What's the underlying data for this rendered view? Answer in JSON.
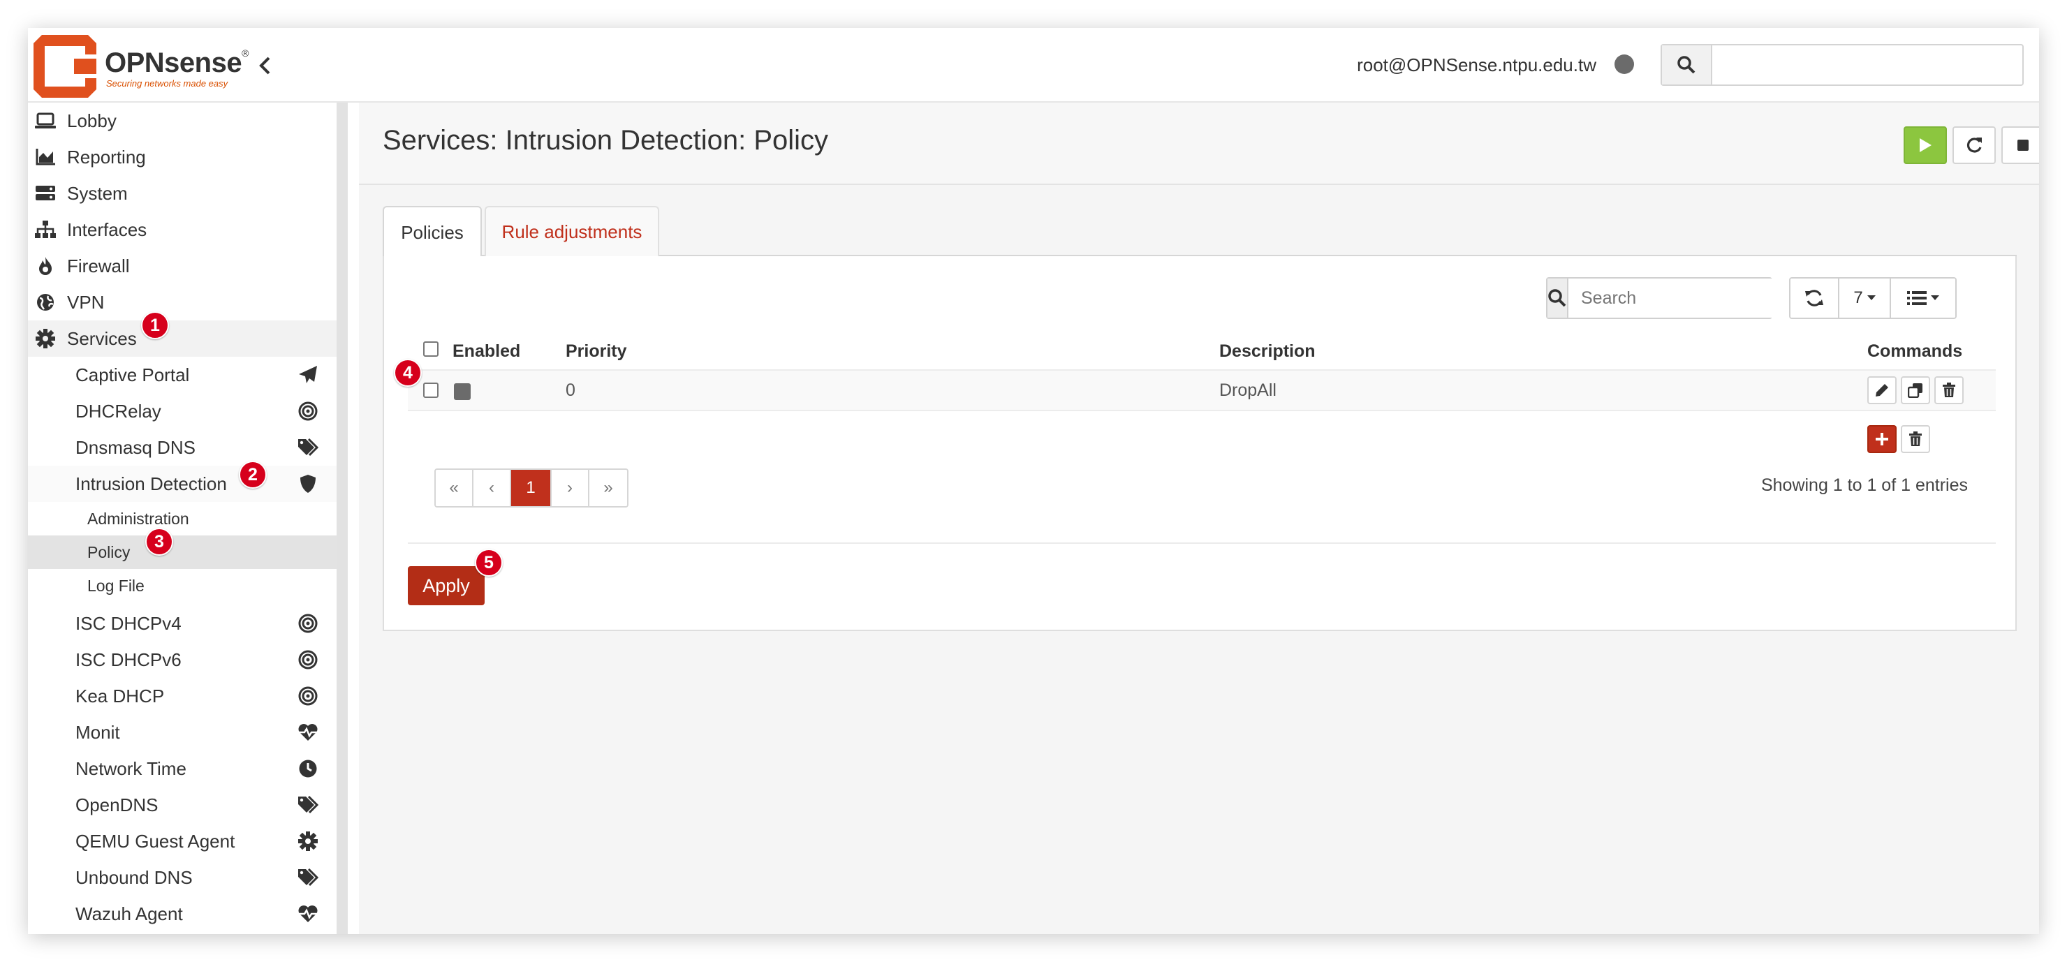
{
  "brand": {
    "name": "OPNsense",
    "registered": "®",
    "tagline": "Securing networks made easy",
    "accent": "#d94f00"
  },
  "header": {
    "user": "root@OPNSense.ntpu.edu.tw",
    "search_placeholder": "",
    "status_color": "#6b6b6b"
  },
  "sidebar": {
    "items": [
      {
        "label": "Lobby",
        "icon": "laptop-icon"
      },
      {
        "label": "Reporting",
        "icon": "area-chart-icon"
      },
      {
        "label": "System",
        "icon": "server-icon"
      },
      {
        "label": "Interfaces",
        "icon": "sitemap-icon"
      },
      {
        "label": "Firewall",
        "icon": "fire-icon"
      },
      {
        "label": "VPN",
        "icon": "globe-icon"
      },
      {
        "label": "Services",
        "icon": "gear-icon"
      }
    ],
    "services": [
      {
        "label": "Captive Portal",
        "icon": "paper-plane-icon"
      },
      {
        "label": "DHCRelay",
        "icon": "bullseye-icon"
      },
      {
        "label": "Dnsmasq DNS",
        "icon": "tags-icon"
      },
      {
        "label": "Intrusion Detection",
        "icon": "shield-icon"
      },
      {
        "label": "ISC DHCPv4",
        "icon": "bullseye-icon"
      },
      {
        "label": "ISC DHCPv6",
        "icon": "bullseye-icon"
      },
      {
        "label": "Kea DHCP",
        "icon": "bullseye-icon"
      },
      {
        "label": "Monit",
        "icon": "heartbeat-icon"
      },
      {
        "label": "Network Time",
        "icon": "clock-icon"
      },
      {
        "label": "OpenDNS",
        "icon": "tags-icon"
      },
      {
        "label": "QEMU Guest Agent",
        "icon": "gear-icon"
      },
      {
        "label": "Unbound DNS",
        "icon": "tags-icon"
      },
      {
        "label": "Wazuh Agent",
        "icon": "heartbeat-icon"
      }
    ],
    "ids_children": [
      "Administration",
      "Policy",
      "Log File"
    ]
  },
  "page": {
    "title": "Services: Intrusion Detection: Policy",
    "tabs": [
      "Policies",
      "Rule adjustments"
    ],
    "grid": {
      "search_placeholder": "Search",
      "page_size": "7",
      "columns": [
        "Enabled",
        "Priority",
        "Description",
        "Commands"
      ],
      "rows": [
        {
          "enabled": true,
          "priority": "0",
          "description": "DropAll"
        }
      ],
      "pager": [
        "«",
        "‹",
        "1",
        "›",
        "»"
      ],
      "showing": "Showing 1 to 1 of 1 entries"
    },
    "apply_label": "Apply"
  },
  "annotations": [
    "1",
    "2",
    "3",
    "4",
    "5"
  ],
  "colors": {
    "primary_red": "#c0301c",
    "play_green": "#8cc63f",
    "badge_red": "#d6001c"
  }
}
